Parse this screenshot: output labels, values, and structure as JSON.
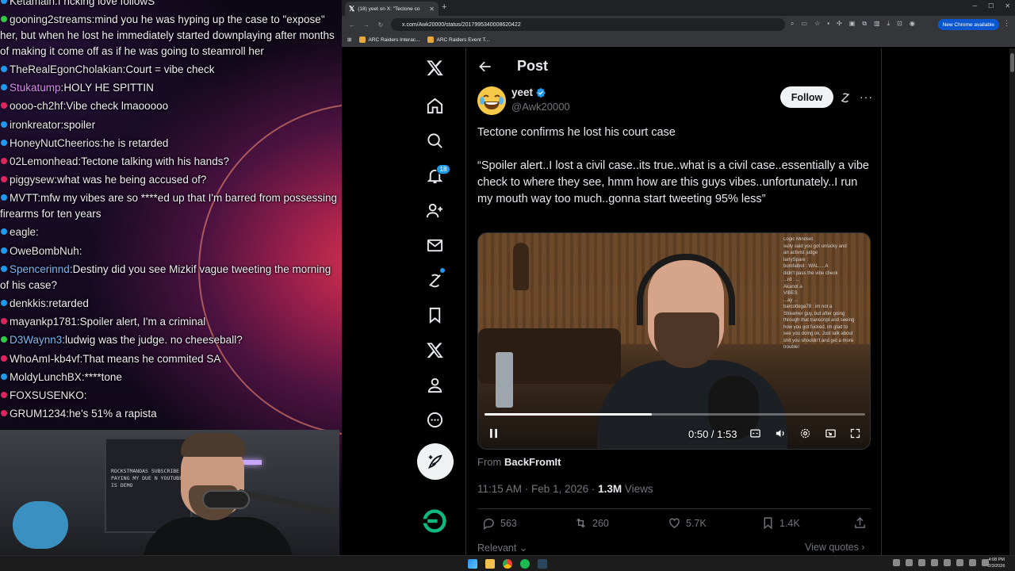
{
  "stream_chat": {
    "lines": [
      {
        "user": "Ketamain",
        "user_color": "#e8e8e8",
        "badge_color": "#1d9bf0",
        "text": "f ncking love followS"
      },
      {
        "user": "gooning2streams",
        "user_color": "#e8e8e8",
        "badge_color": "#2ecc40",
        "text": "mind you he was hyping up the case to \"expose\" her, but when he lost he immediately started downplaying after months of making it come off as if he was going to steamroll her"
      },
      {
        "user": "TheRealEgonCholakian",
        "user_color": "#e8e8e8",
        "badge_color": "#1d9bf0",
        "text": "Court = vibe check"
      },
      {
        "user": "Stukatump",
        "user_color": "#d98bf0",
        "badge_color": "#1d9bf0",
        "text": "HOLY HE SPITTIN"
      },
      {
        "user": "oooo-ch2hf",
        "user_color": "#e8e8e8",
        "badge_color": "#e0245e",
        "text": "Vibe check lmaooooo"
      },
      {
        "user": "ironkreator",
        "user_color": "#e8e8e8",
        "badge_color": "#1d9bf0",
        "text": "spoiler"
      },
      {
        "user": "HoneyNutCheerios",
        "user_color": "#e8e8e8",
        "badge_color": "#1d9bf0",
        "text": "he is retarded"
      },
      {
        "user": "02Lemonhead",
        "user_color": "#e8e8e8",
        "badge_color": "#e0245e",
        "text": "Tectone talking with his hands?"
      },
      {
        "user": "piggysew",
        "user_color": "#e8e8e8",
        "badge_color": "#e0245e",
        "text": "what was he being accused of?"
      },
      {
        "user": "MVTT",
        "user_color": "#e8e8e8",
        "badge_color": "#1d9bf0",
        "text": "mfw my vibes are so ****ed up that I'm barred from possessing firearms for ten years"
      },
      {
        "user": "eagle",
        "user_color": "#e8e8e8",
        "badge_color": "#1d9bf0",
        "text": ""
      },
      {
        "user": "OweBombNuh",
        "user_color": "#e8e8e8",
        "badge_color": "#1d9bf0",
        "text": ""
      },
      {
        "user": "Spencerinnd",
        "user_color": "#7db8f5",
        "badge_color": "#1d9bf0",
        "text": "Destiny did you see Mizkif vague tweeting the morning of his case?"
      },
      {
        "user": "denkkis",
        "user_color": "#e8e8e8",
        "badge_color": "#1d9bf0",
        "text": "retarded"
      },
      {
        "user": "mayankp1781",
        "user_color": "#e8e8e8",
        "badge_color": "#e0245e",
        "text": "Spoiler alert, I'm a criminal"
      },
      {
        "user": "D3Waynn3",
        "user_color": "#7db8f5",
        "badge_color": "#2ecc40",
        "text": "ludwig was the judge. no cheeseball?"
      },
      {
        "user": "WhoAmI-kb4vf",
        "user_color": "#e8e8e8",
        "badge_color": "#e0245e",
        "text": "That means he commited SA"
      },
      {
        "user": "MoldyLunchBX",
        "user_color": "#e8e8e8",
        "badge_color": "#1d9bf0",
        "text": "****tone"
      },
      {
        "user": "FOXSUSENKO",
        "user_color": "#e8e8e8",
        "badge_color": "#e0245e",
        "text": ""
      },
      {
        "user": "GRUM1234",
        "user_color": "#e8e8e8",
        "badge_color": "#e0245e",
        "text": "he's 51% a rapista"
      }
    ]
  },
  "webcam": {
    "shelf_text": "ROCKSTMANDAS SUBSCRIBE PAYING MY DUE N YOUTUBE IS DEMO"
  },
  "browser": {
    "tab_title": "(18) yeet on X: \"Tectone co",
    "url": "x.com/Awk20000/status/2017995340008620422",
    "bookmarks": [
      "ARC Raiders Interac...",
      "ARC Raiders Event T..."
    ],
    "update_label": "New Chrome available"
  },
  "x_nav": {
    "notification_count": "18"
  },
  "post": {
    "header_title": "Post",
    "display_name": "yeet",
    "handle": "@Awk20000",
    "follow_label": "Follow",
    "text_line1": "Tectone confirms he lost his court case",
    "text_line2": "“Spoiler alert..I lost a civil case..its true..what is a civil case..essentially a vibe check to where they see, hmm how are this guys vibes..unfortunately..I run my mouth way too much..gonna start tweeting 95% less”",
    "video": {
      "time": "0:50 / 1:53",
      "progress": 0.44,
      "overlay_chat": [
        "Logic Mindset",
        "sully said you got unlucky and",
        "an activist judge",
        "larrySpare :",
        "bumfalbot : WAL.....A",
        "didn't pass the vibe check",
        "...rd : ...",
        "Akanot a",
        "VIBES",
        "...ay ...",
        "barcottega78 : im not a",
        "Streamer guy, but after going",
        "through that transcript and seeing",
        "how you got fucked, im glad to",
        "see you doing ok. Just talk about",
        "shit you shouldn't and get a more",
        "trouble!"
      ]
    },
    "from_label": "From",
    "from_source": "BackFromIt",
    "timestamp": "11:15 AM · Feb 1, 2026 · ",
    "views_count": "1.3M",
    "views_label": " Views",
    "replies": "563",
    "reposts": "260",
    "likes": "5.7K",
    "bookmarks": "1.4K",
    "relevant_label": "Relevant ⌄",
    "view_quotes_label": "View quotes ›"
  },
  "taskbar": {
    "time": "4:08 PM",
    "date": "2/3/2026"
  },
  "colors": {
    "x_blue": "#1d9bf0",
    "x_text": "#e7e9ea",
    "x_muted": "#71767b"
  }
}
